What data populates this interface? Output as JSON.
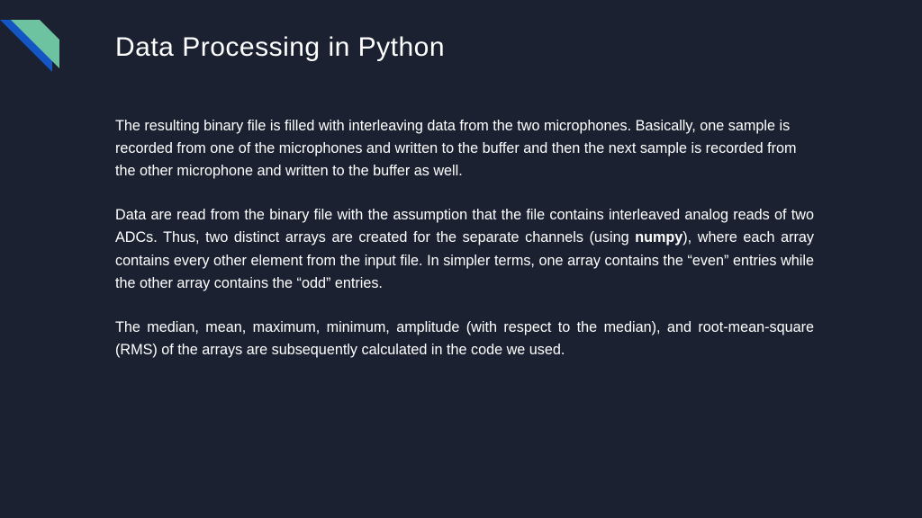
{
  "slide": {
    "title": "Data Processing in Python",
    "p1": "The resulting binary file is filled with interleaving data from the two microphones. Basically, one sample is recorded from one of the microphones and written to the buffer and then the next sample is recorded from the other microphone and written to the buffer as well.",
    "p2a": "Data are read from the binary file with the assumption that the file contains interleaved analog reads of two ADCs. Thus, two distinct arrays are created for the separate channels (using ",
    "p2_bold": "numpy",
    "p2b": "), where each array contains every other element from the input file. In simpler terms, one array contains the “even” entries while the other array contains the “odd” entries.",
    "p3": "The median, mean, maximum, minimum, amplitude (with respect to the median), and root-mean-square (RMS) of the arrays are subsequently calculated in the code we used."
  },
  "accent": {
    "color_blue": "#1356c4",
    "color_teal": "#6dc2a0"
  }
}
